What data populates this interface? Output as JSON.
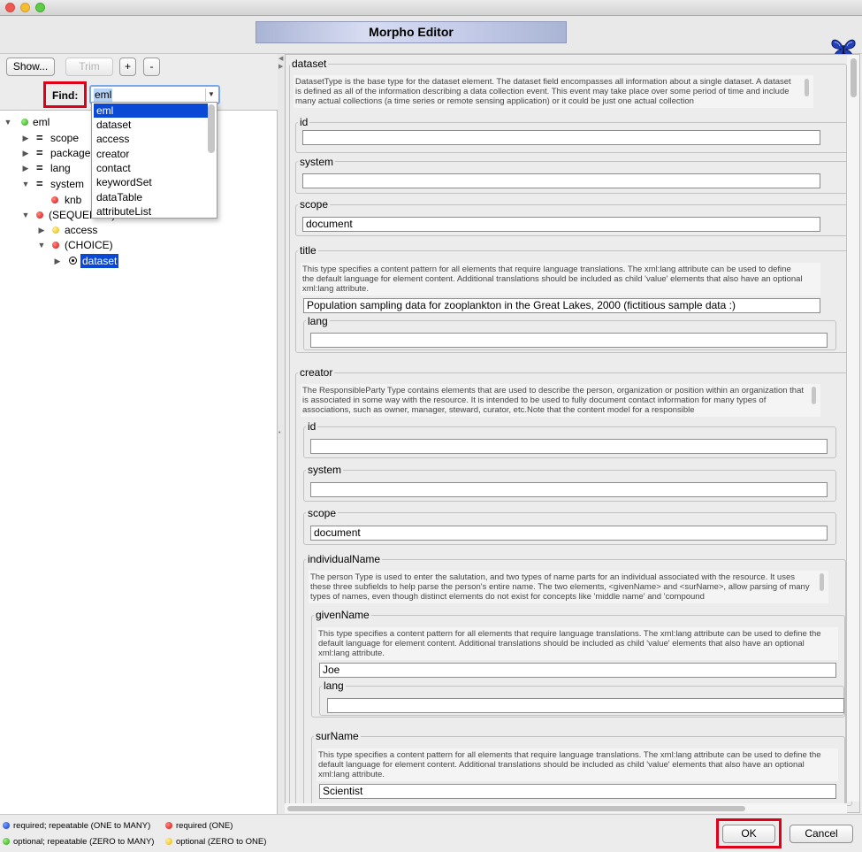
{
  "window": {
    "title": "Morpho Editor"
  },
  "toolbar": {
    "show_label": "Show...",
    "trim_label": "Trim",
    "add_label": "+",
    "remove_label": "-"
  },
  "find": {
    "label": "Find:",
    "value": "eml",
    "options": [
      "eml",
      "dataset",
      "access",
      "creator",
      "contact",
      "keywordSet",
      "dataTable",
      "attributeList"
    ]
  },
  "tree": {
    "nodes": [
      {
        "label": "eml",
        "icon": "green-dot"
      },
      {
        "label": "scope",
        "icon": "equals"
      },
      {
        "label": "package",
        "icon": "equals"
      },
      {
        "label": "lang",
        "icon": "equals"
      },
      {
        "label": "system",
        "icon": "equals"
      },
      {
        "label": "knb",
        "icon": "red-dot"
      },
      {
        "label": "(SEQUENCE)",
        "icon": "red-dot"
      },
      {
        "label": "access",
        "icon": "yellow-dot"
      },
      {
        "label": "(CHOICE)",
        "icon": "red-dot"
      },
      {
        "label": "dataset",
        "icon": "radio-selected"
      }
    ]
  },
  "editor": {
    "dataset": {
      "legend": "dataset",
      "desc": "DatasetType is the base type for the dataset element. The dataset field encompasses all information about a single dataset. A dataset is defined as all of the information describing a data collection event. This event may take place over some period of time and include many actual collections (a time series or remote sensing application) or it could be just one actual collection"
    },
    "id": {
      "legend": "id",
      "value": ""
    },
    "system": {
      "legend": "system",
      "value": ""
    },
    "scope": {
      "legend": "scope",
      "value": "document"
    },
    "title": {
      "legend": "title",
      "desc": "This type specifies a content pattern for all elements  that require language translations. The xml:lang attribute  can be used to define the default language for element content.  Additional translations should be included as child 'value'  elements that also have an optional xml:lang attribute.",
      "value": "Population sampling data for zooplankton in the Great Lakes,       2000 (fictitious sample data :)",
      "lang_legend": "lang",
      "lang_value": ""
    },
    "creator": {
      "legend": "creator",
      "desc": "The ResponsibleParty Type contains  elements that are used to describe the person, organization or position within an organization that is associated in some way with the resource. It is intended to be used to fully document contact information for many types of associations, such as owner, manager, steward, curator, etc.Note that the content model for a responsible",
      "id_legend": "id",
      "id_value": "",
      "system_legend": "system",
      "system_value": "",
      "scope_legend": "scope",
      "scope_value": "document",
      "individualName": {
        "legend": "individualName",
        "desc": "The person Type is used to enter the salutation, and  two types of name parts for an individual associated with the resource. It uses these three subfields to help parse the person's entire name. The two elements, <givenName> and <surName>, allow parsing of many types of names, even though distinct elements  do not exist for concepts like 'middle name' and 'compound",
        "givenName": {
          "legend": "givenName",
          "desc": "This type specifies a content pattern for all elements  that require language translations. The xml:lang attribute  can be used to define the default language for element content.  Additional translations should be included as child 'value'  elements that also have an optional xml:lang attribute.",
          "value": "Joe",
          "lang_legend": "lang",
          "lang_value": ""
        },
        "surName": {
          "legend": "surName",
          "desc": "This type specifies a content pattern for all elements  that require language translations. The xml:lang attribute  can be used to define the default language for element content.  Additional translations should be included as child 'value'  elements that also have an optional xml:lang attribute.",
          "value": "Scientist"
        }
      }
    }
  },
  "legend": {
    "blue": "required; repeatable (ONE to MANY)",
    "red": "required (ONE)",
    "green": "optional; repeatable (ZERO to MANY)",
    "yellow": "optional (ZERO to ONE)"
  },
  "dialog": {
    "ok_label": "OK",
    "cancel_label": "Cancel"
  },
  "colors": {
    "highlight_red": "#e0001a",
    "selection_blue": "#0a49d6"
  }
}
